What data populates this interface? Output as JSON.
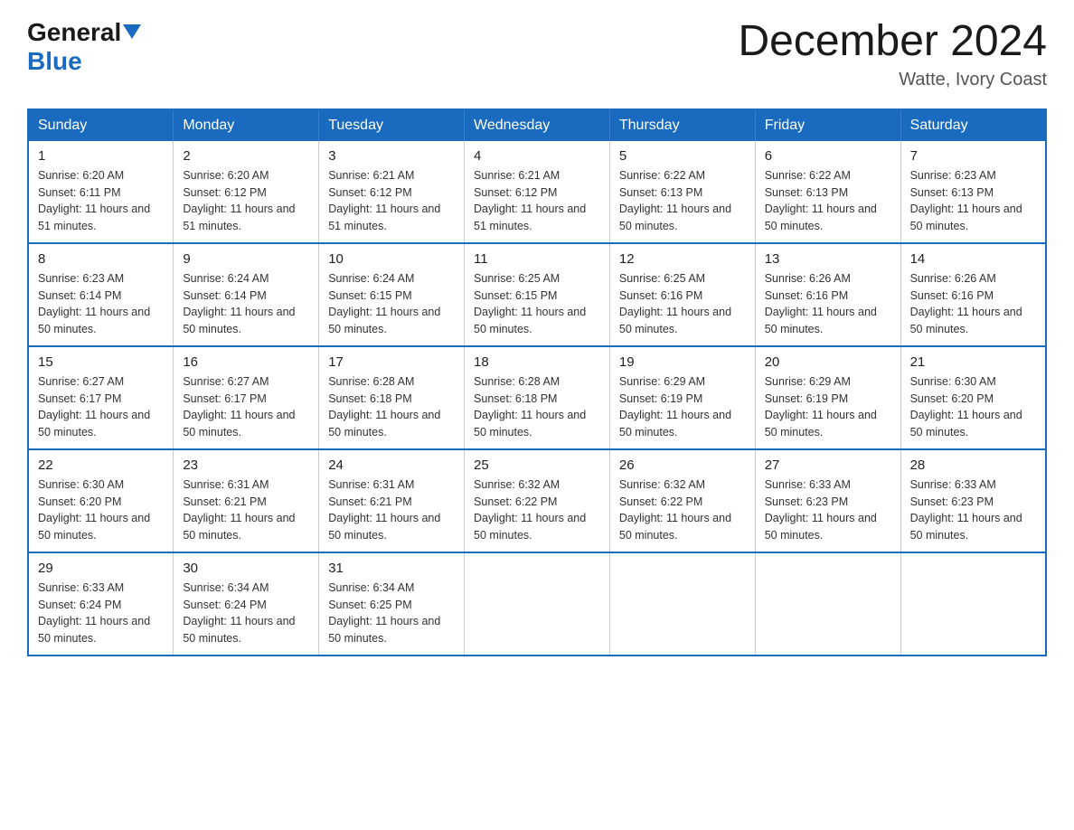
{
  "header": {
    "logo_general": "General",
    "logo_blue": "Blue",
    "month_title": "December 2024",
    "location": "Watte, Ivory Coast"
  },
  "days_of_week": [
    "Sunday",
    "Monday",
    "Tuesday",
    "Wednesday",
    "Thursday",
    "Friday",
    "Saturday"
  ],
  "weeks": [
    [
      {
        "day": "1",
        "sunrise": "6:20 AM",
        "sunset": "6:11 PM",
        "daylight": "11 hours and 51 minutes."
      },
      {
        "day": "2",
        "sunrise": "6:20 AM",
        "sunset": "6:12 PM",
        "daylight": "11 hours and 51 minutes."
      },
      {
        "day": "3",
        "sunrise": "6:21 AM",
        "sunset": "6:12 PM",
        "daylight": "11 hours and 51 minutes."
      },
      {
        "day": "4",
        "sunrise": "6:21 AM",
        "sunset": "6:12 PM",
        "daylight": "11 hours and 51 minutes."
      },
      {
        "day": "5",
        "sunrise": "6:22 AM",
        "sunset": "6:13 PM",
        "daylight": "11 hours and 50 minutes."
      },
      {
        "day": "6",
        "sunrise": "6:22 AM",
        "sunset": "6:13 PM",
        "daylight": "11 hours and 50 minutes."
      },
      {
        "day": "7",
        "sunrise": "6:23 AM",
        "sunset": "6:13 PM",
        "daylight": "11 hours and 50 minutes."
      }
    ],
    [
      {
        "day": "8",
        "sunrise": "6:23 AM",
        "sunset": "6:14 PM",
        "daylight": "11 hours and 50 minutes."
      },
      {
        "day": "9",
        "sunrise": "6:24 AM",
        "sunset": "6:14 PM",
        "daylight": "11 hours and 50 minutes."
      },
      {
        "day": "10",
        "sunrise": "6:24 AM",
        "sunset": "6:15 PM",
        "daylight": "11 hours and 50 minutes."
      },
      {
        "day": "11",
        "sunrise": "6:25 AM",
        "sunset": "6:15 PM",
        "daylight": "11 hours and 50 minutes."
      },
      {
        "day": "12",
        "sunrise": "6:25 AM",
        "sunset": "6:16 PM",
        "daylight": "11 hours and 50 minutes."
      },
      {
        "day": "13",
        "sunrise": "6:26 AM",
        "sunset": "6:16 PM",
        "daylight": "11 hours and 50 minutes."
      },
      {
        "day": "14",
        "sunrise": "6:26 AM",
        "sunset": "6:16 PM",
        "daylight": "11 hours and 50 minutes."
      }
    ],
    [
      {
        "day": "15",
        "sunrise": "6:27 AM",
        "sunset": "6:17 PM",
        "daylight": "11 hours and 50 minutes."
      },
      {
        "day": "16",
        "sunrise": "6:27 AM",
        "sunset": "6:17 PM",
        "daylight": "11 hours and 50 minutes."
      },
      {
        "day": "17",
        "sunrise": "6:28 AM",
        "sunset": "6:18 PM",
        "daylight": "11 hours and 50 minutes."
      },
      {
        "day": "18",
        "sunrise": "6:28 AM",
        "sunset": "6:18 PM",
        "daylight": "11 hours and 50 minutes."
      },
      {
        "day": "19",
        "sunrise": "6:29 AM",
        "sunset": "6:19 PM",
        "daylight": "11 hours and 50 minutes."
      },
      {
        "day": "20",
        "sunrise": "6:29 AM",
        "sunset": "6:19 PM",
        "daylight": "11 hours and 50 minutes."
      },
      {
        "day": "21",
        "sunrise": "6:30 AM",
        "sunset": "6:20 PM",
        "daylight": "11 hours and 50 minutes."
      }
    ],
    [
      {
        "day": "22",
        "sunrise": "6:30 AM",
        "sunset": "6:20 PM",
        "daylight": "11 hours and 50 minutes."
      },
      {
        "day": "23",
        "sunrise": "6:31 AM",
        "sunset": "6:21 PM",
        "daylight": "11 hours and 50 minutes."
      },
      {
        "day": "24",
        "sunrise": "6:31 AM",
        "sunset": "6:21 PM",
        "daylight": "11 hours and 50 minutes."
      },
      {
        "day": "25",
        "sunrise": "6:32 AM",
        "sunset": "6:22 PM",
        "daylight": "11 hours and 50 minutes."
      },
      {
        "day": "26",
        "sunrise": "6:32 AM",
        "sunset": "6:22 PM",
        "daylight": "11 hours and 50 minutes."
      },
      {
        "day": "27",
        "sunrise": "6:33 AM",
        "sunset": "6:23 PM",
        "daylight": "11 hours and 50 minutes."
      },
      {
        "day": "28",
        "sunrise": "6:33 AM",
        "sunset": "6:23 PM",
        "daylight": "11 hours and 50 minutes."
      }
    ],
    [
      {
        "day": "29",
        "sunrise": "6:33 AM",
        "sunset": "6:24 PM",
        "daylight": "11 hours and 50 minutes."
      },
      {
        "day": "30",
        "sunrise": "6:34 AM",
        "sunset": "6:24 PM",
        "daylight": "11 hours and 50 minutes."
      },
      {
        "day": "31",
        "sunrise": "6:34 AM",
        "sunset": "6:25 PM",
        "daylight": "11 hours and 50 minutes."
      },
      null,
      null,
      null,
      null
    ]
  ]
}
